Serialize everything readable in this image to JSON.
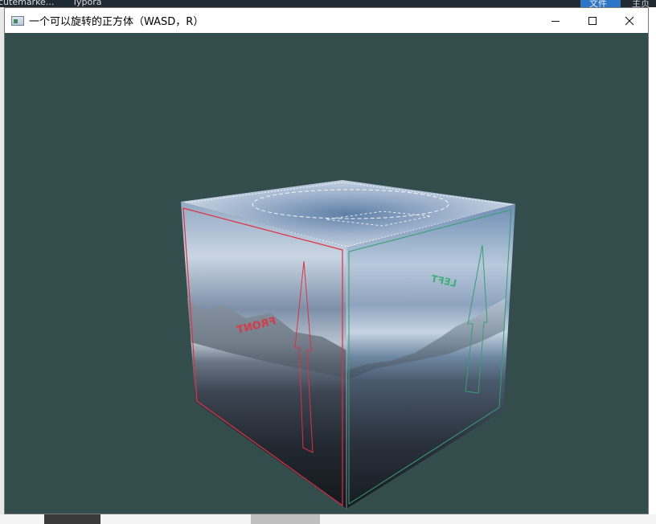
{
  "background_apps": {
    "tabs": [
      "cutemarke...",
      "Typora"
    ],
    "right_tabs": [
      "文件",
      "主页"
    ]
  },
  "window": {
    "title": "一个可以旋转的正方体（WASD，R）",
    "controls": {
      "minimize_icon": "minimize-icon",
      "maximize_icon": "maximize-icon",
      "close_icon": "close-icon"
    }
  },
  "scene": {
    "clear_color": "#334d4d",
    "cube_texture": "skybox",
    "face_labels": {
      "front": "FRONT",
      "left": "LEFT"
    },
    "colors": {
      "front_outline": "#e03040",
      "left_outline": "#35a070",
      "top_outline": "#e8eef6"
    }
  }
}
